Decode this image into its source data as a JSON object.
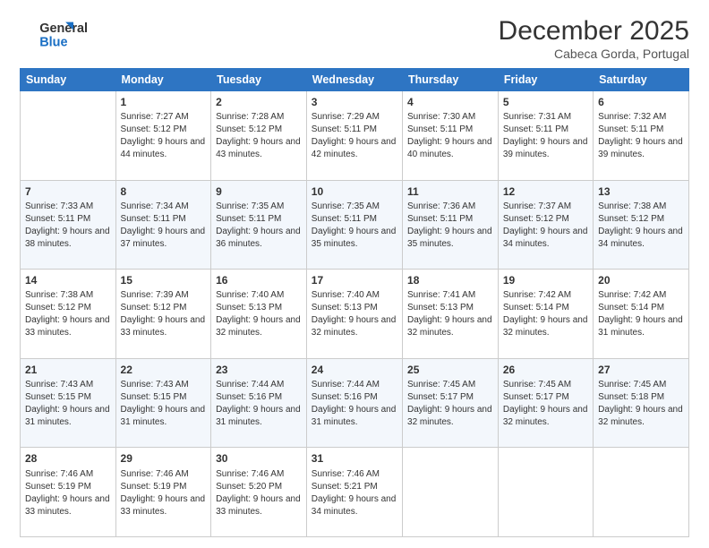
{
  "logo": {
    "line1": "General",
    "line2": "Blue"
  },
  "header": {
    "month": "December 2025",
    "location": "Cabeca Gorda, Portugal"
  },
  "weekdays": [
    "Sunday",
    "Monday",
    "Tuesday",
    "Wednesday",
    "Thursday",
    "Friday",
    "Saturday"
  ],
  "weeks": [
    [
      {
        "day": "",
        "sunrise": "",
        "sunset": "",
        "daylight": ""
      },
      {
        "day": "1",
        "sunrise": "Sunrise: 7:27 AM",
        "sunset": "Sunset: 5:12 PM",
        "daylight": "Daylight: 9 hours and 44 minutes."
      },
      {
        "day": "2",
        "sunrise": "Sunrise: 7:28 AM",
        "sunset": "Sunset: 5:12 PM",
        "daylight": "Daylight: 9 hours and 43 minutes."
      },
      {
        "day": "3",
        "sunrise": "Sunrise: 7:29 AM",
        "sunset": "Sunset: 5:11 PM",
        "daylight": "Daylight: 9 hours and 42 minutes."
      },
      {
        "day": "4",
        "sunrise": "Sunrise: 7:30 AM",
        "sunset": "Sunset: 5:11 PM",
        "daylight": "Daylight: 9 hours and 40 minutes."
      },
      {
        "day": "5",
        "sunrise": "Sunrise: 7:31 AM",
        "sunset": "Sunset: 5:11 PM",
        "daylight": "Daylight: 9 hours and 39 minutes."
      },
      {
        "day": "6",
        "sunrise": "Sunrise: 7:32 AM",
        "sunset": "Sunset: 5:11 PM",
        "daylight": "Daylight: 9 hours and 39 minutes."
      }
    ],
    [
      {
        "day": "7",
        "sunrise": "Sunrise: 7:33 AM",
        "sunset": "Sunset: 5:11 PM",
        "daylight": "Daylight: 9 hours and 38 minutes."
      },
      {
        "day": "8",
        "sunrise": "Sunrise: 7:34 AM",
        "sunset": "Sunset: 5:11 PM",
        "daylight": "Daylight: 9 hours and 37 minutes."
      },
      {
        "day": "9",
        "sunrise": "Sunrise: 7:35 AM",
        "sunset": "Sunset: 5:11 PM",
        "daylight": "Daylight: 9 hours and 36 minutes."
      },
      {
        "day": "10",
        "sunrise": "Sunrise: 7:35 AM",
        "sunset": "Sunset: 5:11 PM",
        "daylight": "Daylight: 9 hours and 35 minutes."
      },
      {
        "day": "11",
        "sunrise": "Sunrise: 7:36 AM",
        "sunset": "Sunset: 5:11 PM",
        "daylight": "Daylight: 9 hours and 35 minutes."
      },
      {
        "day": "12",
        "sunrise": "Sunrise: 7:37 AM",
        "sunset": "Sunset: 5:12 PM",
        "daylight": "Daylight: 9 hours and 34 minutes."
      },
      {
        "day": "13",
        "sunrise": "Sunrise: 7:38 AM",
        "sunset": "Sunset: 5:12 PM",
        "daylight": "Daylight: 9 hours and 34 minutes."
      }
    ],
    [
      {
        "day": "14",
        "sunrise": "Sunrise: 7:38 AM",
        "sunset": "Sunset: 5:12 PM",
        "daylight": "Daylight: 9 hours and 33 minutes."
      },
      {
        "day": "15",
        "sunrise": "Sunrise: 7:39 AM",
        "sunset": "Sunset: 5:12 PM",
        "daylight": "Daylight: 9 hours and 33 minutes."
      },
      {
        "day": "16",
        "sunrise": "Sunrise: 7:40 AM",
        "sunset": "Sunset: 5:13 PM",
        "daylight": "Daylight: 9 hours and 32 minutes."
      },
      {
        "day": "17",
        "sunrise": "Sunrise: 7:40 AM",
        "sunset": "Sunset: 5:13 PM",
        "daylight": "Daylight: 9 hours and 32 minutes."
      },
      {
        "day": "18",
        "sunrise": "Sunrise: 7:41 AM",
        "sunset": "Sunset: 5:13 PM",
        "daylight": "Daylight: 9 hours and 32 minutes."
      },
      {
        "day": "19",
        "sunrise": "Sunrise: 7:42 AM",
        "sunset": "Sunset: 5:14 PM",
        "daylight": "Daylight: 9 hours and 32 minutes."
      },
      {
        "day": "20",
        "sunrise": "Sunrise: 7:42 AM",
        "sunset": "Sunset: 5:14 PM",
        "daylight": "Daylight: 9 hours and 31 minutes."
      }
    ],
    [
      {
        "day": "21",
        "sunrise": "Sunrise: 7:43 AM",
        "sunset": "Sunset: 5:15 PM",
        "daylight": "Daylight: 9 hours and 31 minutes."
      },
      {
        "day": "22",
        "sunrise": "Sunrise: 7:43 AM",
        "sunset": "Sunset: 5:15 PM",
        "daylight": "Daylight: 9 hours and 31 minutes."
      },
      {
        "day": "23",
        "sunrise": "Sunrise: 7:44 AM",
        "sunset": "Sunset: 5:16 PM",
        "daylight": "Daylight: 9 hours and 31 minutes."
      },
      {
        "day": "24",
        "sunrise": "Sunrise: 7:44 AM",
        "sunset": "Sunset: 5:16 PM",
        "daylight": "Daylight: 9 hours and 31 minutes."
      },
      {
        "day": "25",
        "sunrise": "Sunrise: 7:45 AM",
        "sunset": "Sunset: 5:17 PM",
        "daylight": "Daylight: 9 hours and 32 minutes."
      },
      {
        "day": "26",
        "sunrise": "Sunrise: 7:45 AM",
        "sunset": "Sunset: 5:17 PM",
        "daylight": "Daylight: 9 hours and 32 minutes."
      },
      {
        "day": "27",
        "sunrise": "Sunrise: 7:45 AM",
        "sunset": "Sunset: 5:18 PM",
        "daylight": "Daylight: 9 hours and 32 minutes."
      }
    ],
    [
      {
        "day": "28",
        "sunrise": "Sunrise: 7:46 AM",
        "sunset": "Sunset: 5:19 PM",
        "daylight": "Daylight: 9 hours and 33 minutes."
      },
      {
        "day": "29",
        "sunrise": "Sunrise: 7:46 AM",
        "sunset": "Sunset: 5:19 PM",
        "daylight": "Daylight: 9 hours and 33 minutes."
      },
      {
        "day": "30",
        "sunrise": "Sunrise: 7:46 AM",
        "sunset": "Sunset: 5:20 PM",
        "daylight": "Daylight: 9 hours and 33 minutes."
      },
      {
        "day": "31",
        "sunrise": "Sunrise: 7:46 AM",
        "sunset": "Sunset: 5:21 PM",
        "daylight": "Daylight: 9 hours and 34 minutes."
      },
      {
        "day": "",
        "sunrise": "",
        "sunset": "",
        "daylight": ""
      },
      {
        "day": "",
        "sunrise": "",
        "sunset": "",
        "daylight": ""
      },
      {
        "day": "",
        "sunrise": "",
        "sunset": "",
        "daylight": ""
      }
    ]
  ]
}
